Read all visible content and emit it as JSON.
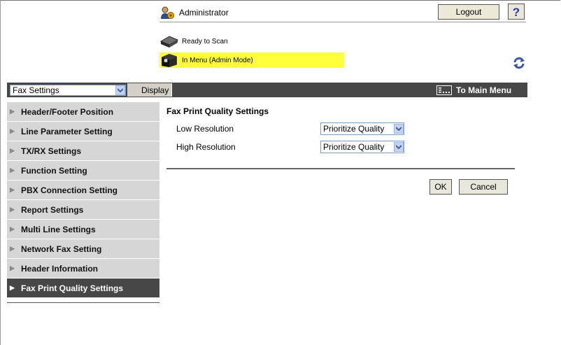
{
  "header": {
    "user_label": "Administrator",
    "logout_label": "Logout",
    "help_label": "?",
    "status_scan": "Ready to Scan",
    "status_menu": "In Menu (Admin Mode)"
  },
  "toolbar": {
    "select_value": "Fax Settings",
    "display_label": "Display",
    "main_menu_label": "To Main Menu"
  },
  "sidebar": {
    "items": [
      {
        "label": "Header/Footer Position"
      },
      {
        "label": "Line Parameter Setting"
      },
      {
        "label": "TX/RX Settings"
      },
      {
        "label": "Function Setting"
      },
      {
        "label": "PBX Connection Setting"
      },
      {
        "label": "Report Settings"
      },
      {
        "label": "Multi Line Settings"
      },
      {
        "label": "Network Fax Setting"
      },
      {
        "label": "Header Information"
      },
      {
        "label": "Fax Print Quality Settings",
        "active": true
      }
    ]
  },
  "main": {
    "title": "Fax Print Quality Settings",
    "rows": [
      {
        "label": "Low Resolution",
        "value": "Prioritize Quality"
      },
      {
        "label": "High Resolution",
        "value": "Prioritize Quality"
      }
    ],
    "ok_label": "OK",
    "cancel_label": "Cancel"
  },
  "colors": {
    "toolbar_bg": "#474747",
    "status_highlight": "#ffff3c",
    "nav_bg": "#d6d6d6",
    "nav_active_bg": "#474747"
  }
}
